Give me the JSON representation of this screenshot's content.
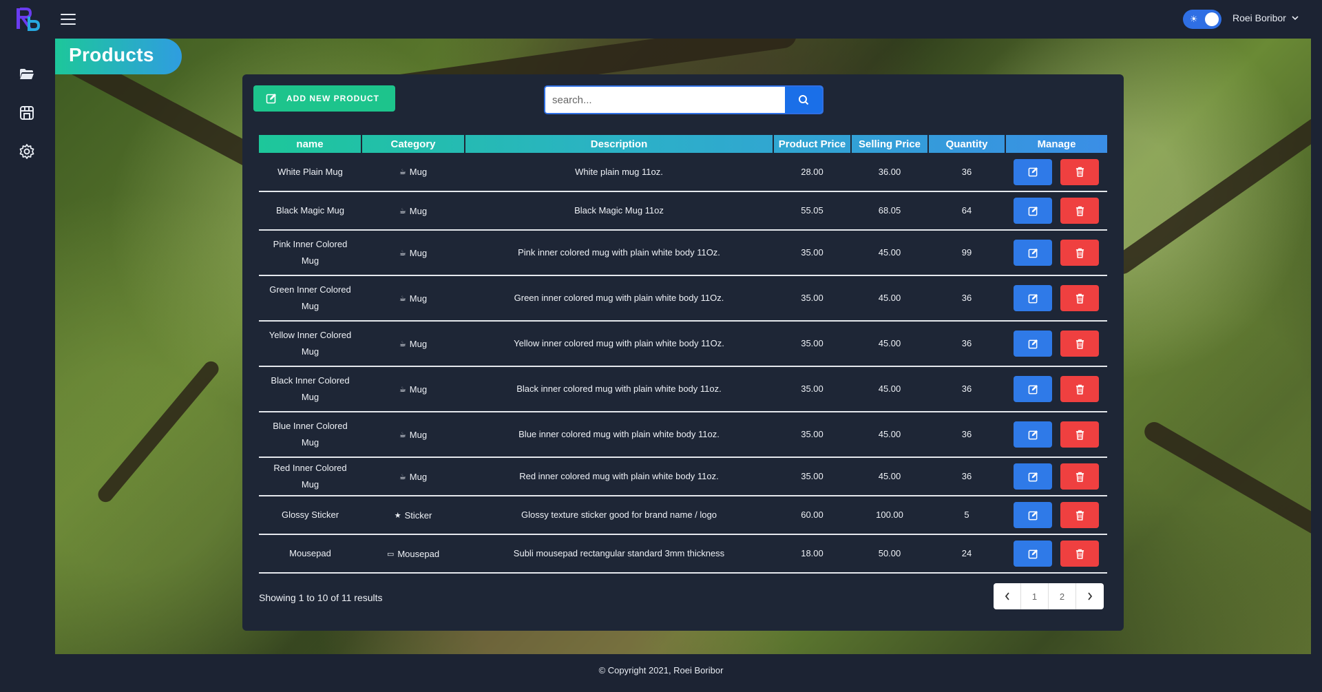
{
  "header": {
    "user_name": "Roei Boribor",
    "theme_toggle_icon": "☀"
  },
  "page": {
    "title": "Products"
  },
  "toolbar": {
    "add_label": "ADD NEW PRODUCT",
    "search_placeholder": "search..."
  },
  "table": {
    "headers": [
      "name",
      "Category",
      "Description",
      "Product Price",
      "Selling Price",
      "Quantity",
      "Manage"
    ],
    "rows": [
      {
        "name": "White Plain Mug",
        "category": "Mug",
        "cat_icon": "☕",
        "description": "White plain mug 11oz.",
        "product_price": "28.00",
        "selling_price": "36.00",
        "quantity": "36"
      },
      {
        "name": "Black Magic Mug",
        "category": "Mug",
        "cat_icon": "☕",
        "description": "Black Magic Mug 11oz",
        "product_price": "55.05",
        "selling_price": "68.05",
        "quantity": "64"
      },
      {
        "name": "Pink Inner Colored Mug",
        "category": "Mug",
        "cat_icon": "☕",
        "description": "Pink inner colored mug with plain white body 11Oz.",
        "product_price": "35.00",
        "selling_price": "45.00",
        "quantity": "99"
      },
      {
        "name": "Green Inner Colored Mug",
        "category": "Mug",
        "cat_icon": "☕",
        "description": "Green inner colored mug with plain white body 11Oz.",
        "product_price": "35.00",
        "selling_price": "45.00",
        "quantity": "36"
      },
      {
        "name": "Yellow Inner Colored Mug",
        "category": "Mug",
        "cat_icon": "☕",
        "description": "Yellow inner colored mug with plain white body 11Oz.",
        "product_price": "35.00",
        "selling_price": "45.00",
        "quantity": "36"
      },
      {
        "name": "Black Inner Colored Mug",
        "category": "Mug",
        "cat_icon": "☕",
        "description": "Black inner colored mug with plain white body 11oz.",
        "product_price": "35.00",
        "selling_price": "45.00",
        "quantity": "36"
      },
      {
        "name": "Blue Inner Colored Mug",
        "category": "Mug",
        "cat_icon": "☕",
        "description": "Blue inner colored mug with plain white body 11oz.",
        "product_price": "35.00",
        "selling_price": "45.00",
        "quantity": "36"
      },
      {
        "name": "Red Inner Colored Mug",
        "category": "Mug",
        "cat_icon": "☕",
        "description": "Red inner colored mug with plain white body 11oz.",
        "product_price": "35.00",
        "selling_price": "45.00",
        "quantity": "36"
      },
      {
        "name": "Glossy Sticker",
        "category": "Sticker",
        "cat_icon": "★",
        "description": "Glossy texture sticker good for brand name / logo",
        "product_price": "60.00",
        "selling_price": "100.00",
        "quantity": "5"
      },
      {
        "name": "Mousepad",
        "category": "Mousepad",
        "cat_icon": "▭",
        "description": "Subli mousepad rectangular standard 3mm thickness",
        "product_price": "18.00",
        "selling_price": "50.00",
        "quantity": "24"
      }
    ]
  },
  "pagination": {
    "summary": "Showing 1 to 10 of 11 results",
    "pages": [
      "1",
      "2"
    ]
  },
  "footer": {
    "copyright": "© Copyright 2021, Roei Boribor"
  },
  "colors": {
    "brand_gradient_start": "#1dc79a",
    "brand_gradient_end": "#2f9de0",
    "edit": "#2f7ae8",
    "delete": "#ef4040",
    "add": "#1dc48c"
  }
}
